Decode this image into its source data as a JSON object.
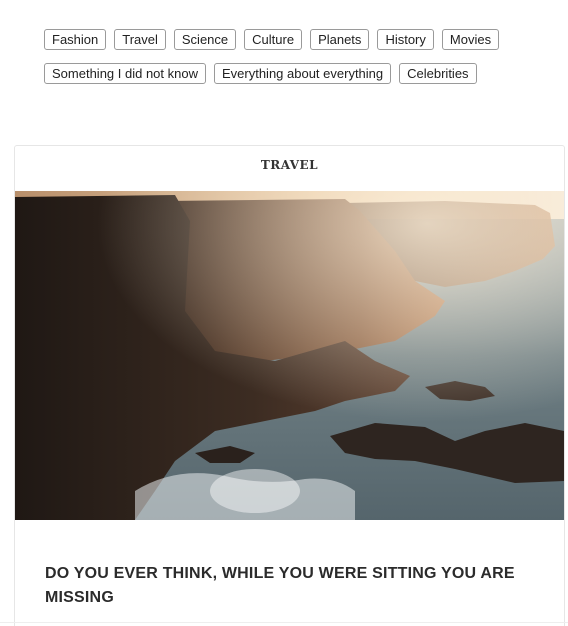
{
  "tags": {
    "items": [
      {
        "label": "Fashion"
      },
      {
        "label": "Travel"
      },
      {
        "label": "Science"
      },
      {
        "label": "Culture"
      },
      {
        "label": "Planets"
      },
      {
        "label": "History"
      },
      {
        "label": "Movies"
      },
      {
        "label": "Something I did not know"
      },
      {
        "label": "Everything about everything"
      },
      {
        "label": "Celebrities"
      }
    ]
  },
  "post": {
    "category": "TRAVEL",
    "image_subject": "sea-cliffs-at-sunset",
    "title": "DO YOU EVER THINK, WHILE YOU WERE SITTING YOU ARE MISSING"
  },
  "colors": {
    "tag_border": "#9a9a9a",
    "text": "#2b2b2b",
    "card_border": "#e6e6e6"
  }
}
